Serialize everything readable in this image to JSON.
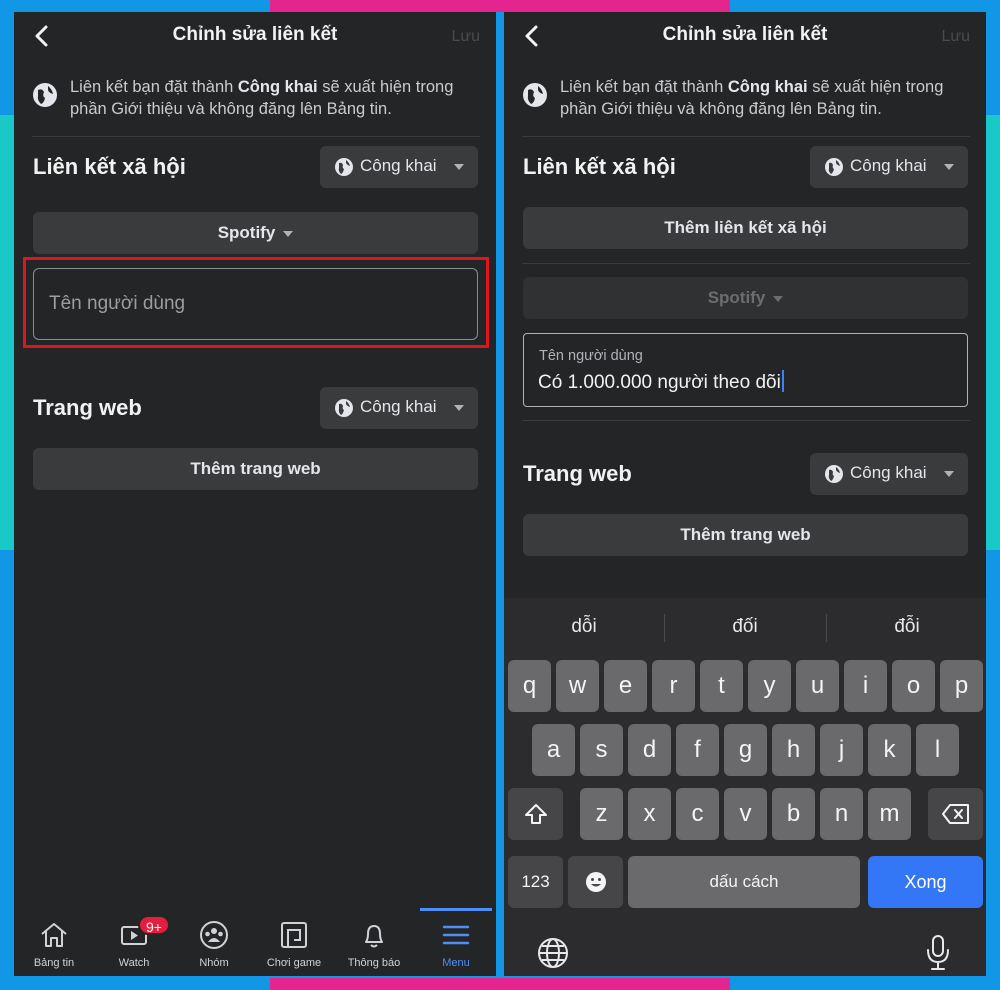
{
  "left": {
    "nav": {
      "title": "Chỉnh sửa liên kết",
      "save": "Lưu"
    },
    "info": {
      "before": "Liên kết bạn đặt thành ",
      "bold": "Công khai",
      "after": " sẽ xuất hiện trong phần Giới thiệu và không đăng lên Bảng tin."
    },
    "social": {
      "title": "Liên kết xã hội",
      "privacy": "Công khai",
      "platform": "Spotify",
      "username_placeholder": "Tên người dùng"
    },
    "web": {
      "title": "Trang web",
      "privacy": "Công khai",
      "add": "Thêm trang web"
    },
    "tabs": [
      {
        "label": "Bảng tin",
        "icon": "home-icon"
      },
      {
        "label": "Watch",
        "icon": "watch-icon",
        "badge": "9+"
      },
      {
        "label": "Nhóm",
        "icon": "groups-icon"
      },
      {
        "label": "Chơi game",
        "icon": "gaming-icon"
      },
      {
        "label": "Thông báo",
        "icon": "bell-icon"
      },
      {
        "label": "Menu",
        "icon": "menu-icon",
        "active": true
      }
    ]
  },
  "right": {
    "nav": {
      "title": "Chỉnh sửa liên kết",
      "save": "Lưu"
    },
    "info": {
      "before": "Liên kết bạn đặt thành ",
      "bold": "Công khai",
      "after": " sẽ xuất hiện trong phần Giới thiệu và không đăng lên Bảng tin."
    },
    "social": {
      "title": "Liên kết xã hội",
      "privacy": "Công khai",
      "add": "Thêm liên kết xã hội",
      "platform": "Spotify",
      "username_label": "Tên người dùng",
      "username_value": "Có 1.000.000 người theo dõi"
    },
    "web": {
      "title": "Trang web",
      "privacy": "Công khai",
      "add": "Thêm trang web"
    },
    "keyboard": {
      "suggestions": [
        "dỗi",
        "đối",
        "đỗi"
      ],
      "row1": [
        "q",
        "w",
        "e",
        "r",
        "t",
        "y",
        "u",
        "i",
        "o",
        "p"
      ],
      "row2": [
        "a",
        "s",
        "d",
        "f",
        "g",
        "h",
        "j",
        "k",
        "l"
      ],
      "row3": [
        "z",
        "x",
        "c",
        "v",
        "b",
        "n",
        "m"
      ],
      "numbers": "123",
      "space": "dấu cách",
      "done": "Xong"
    }
  },
  "colors": {
    "background": "#242526",
    "accent": "#3477f6",
    "highlight": "#e0141e",
    "badge": "#e41e3f"
  }
}
